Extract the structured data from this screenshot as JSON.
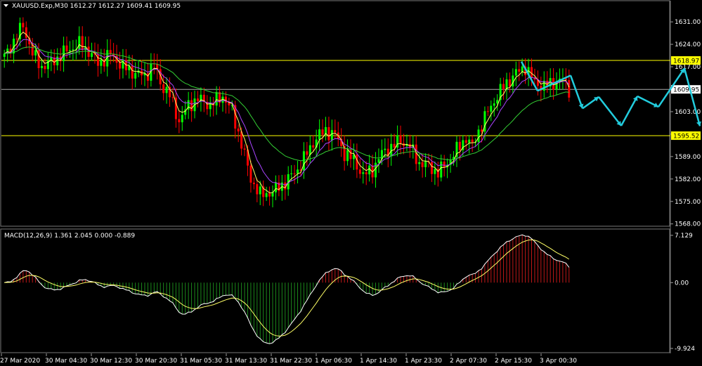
{
  "header": {
    "symbol_line": "XAUUSD.Exp,M30  1612.27 1612.27 1609.41 1609.95",
    "dropdown_icon": "triangle-down-icon"
  },
  "macd": {
    "label": "MACD(12,26,9) 1.361 2.045 0.000 -0.889"
  },
  "colors": {
    "background": "#000000",
    "grid": "#777777",
    "bull": "#00ff00",
    "bear": "#ff0000",
    "ma_fast": "#ffff66",
    "ma_mid": "#aa44ff",
    "ma_slow": "#33cc33",
    "forecast": "#22ccdd",
    "hline": "#ffff00",
    "price_line": "#aaaaaa",
    "macd_hist_pos": "#c01818",
    "macd_hist_neg": "#1c8a1c",
    "macd_line": "#ffffff",
    "signal_line": "#ffff66"
  },
  "chart_data": [
    {
      "type": "candlestick",
      "y_axis_ticks": [
        "1631.00",
        "1624.00",
        "1617.00",
        "1610.00",
        "1603.00",
        "1596.00",
        "1589.00",
        "1582.00",
        "1575.00",
        "1568.00"
      ],
      "ylim": [
        1567.5,
        1633
      ],
      "x_axis_ticks": [
        "27 Mar 2020",
        "30 Mar 04:30",
        "30 Mar 12:30",
        "30 Mar 20:30",
        "31 Mar 05:30",
        "31 Mar 13:30",
        "31 Mar 22:30",
        "1 Apr 06:30",
        "1 Apr 14:30",
        "1 Apr 23:30",
        "2 Apr 07:30",
        "2 Apr 15:30",
        "3 Apr 00:30"
      ],
      "horizontal_lines": [
        {
          "label": "1618.97",
          "value": 1618.97,
          "style": "yellow-box"
        },
        {
          "label": "1609.95",
          "value": 1609.95,
          "style": "current-price"
        },
        {
          "label": "1595.52",
          "value": 1595.52,
          "style": "yellow-box"
        }
      ],
      "close_keypoints": [
        [
          0,
          1620
        ],
        [
          3,
          1625
        ],
        [
          6,
          1630
        ],
        [
          9,
          1621
        ],
        [
          12,
          1617
        ],
        [
          16,
          1619
        ],
        [
          20,
          1622
        ],
        [
          24,
          1624
        ],
        [
          27,
          1622
        ],
        [
          30,
          1618
        ],
        [
          34,
          1621
        ],
        [
          38,
          1617
        ],
        [
          42,
          1615
        ],
        [
          45,
          1614
        ],
        [
          48,
          1618
        ],
        [
          50,
          1612
        ],
        [
          53,
          1608
        ],
        [
          56,
          1600
        ],
        [
          59,
          1605
        ],
        [
          62,
          1607
        ],
        [
          66,
          1605
        ],
        [
          70,
          1608
        ],
        [
          73,
          1603
        ],
        [
          76,
          1593
        ],
        [
          79,
          1582
        ],
        [
          82,
          1577
        ],
        [
          86,
          1578
        ],
        [
          90,
          1581
        ],
        [
          94,
          1585
        ],
        [
          97,
          1590
        ],
        [
          100,
          1595
        ],
        [
          103,
          1597
        ],
        [
          106,
          1596
        ],
        [
          109,
          1590
        ],
        [
          112,
          1588
        ],
        [
          115,
          1583
        ],
        [
          118,
          1585
        ],
        [
          121,
          1590
        ],
        [
          124,
          1592
        ],
        [
          127,
          1594
        ],
        [
          130,
          1592
        ],
        [
          133,
          1587
        ],
        [
          136,
          1586
        ],
        [
          139,
          1584
        ],
        [
          142,
          1587
        ],
        [
          145,
          1591
        ],
        [
          148,
          1595
        ],
        [
          150,
          1592
        ],
        [
          152,
          1597
        ],
        [
          155,
          1603
        ],
        [
          158,
          1608
        ],
        [
          161,
          1612
        ],
        [
          164,
          1615
        ],
        [
          167,
          1617
        ],
        [
          170,
          1612
        ],
        [
          173,
          1611
        ],
        [
          176,
          1612
        ],
        [
          179,
          1613
        ],
        [
          181,
          1610
        ]
      ],
      "forecast_path": [
        [
          1618.6,
          1614.3
        ],
        [
          1614.3,
          1604.0
        ],
        [
          1604.0,
          1607.6
        ],
        [
          1607.6,
          1598.6
        ],
        [
          1598.6,
          1607.8
        ],
        [
          1607.8,
          1604.5
        ],
        [
          1604.5,
          1616.5
        ],
        [
          1616.5,
          1598.5
        ]
      ],
      "series": [
        {
          "name": "",
          "kind": "ma_fast"
        },
        {
          "name": "",
          "kind": "ma_mid"
        },
        {
          "name": "",
          "kind": "ma_slow"
        }
      ]
    },
    {
      "type": "macd",
      "y_axis_ticks": [
        "7.129",
        "0.00",
        "-9.924"
      ],
      "ylim": [
        -9.924,
        7.129
      ],
      "macd": 1.361,
      "signal": 2.045,
      "histogram": -0.889
    }
  ]
}
